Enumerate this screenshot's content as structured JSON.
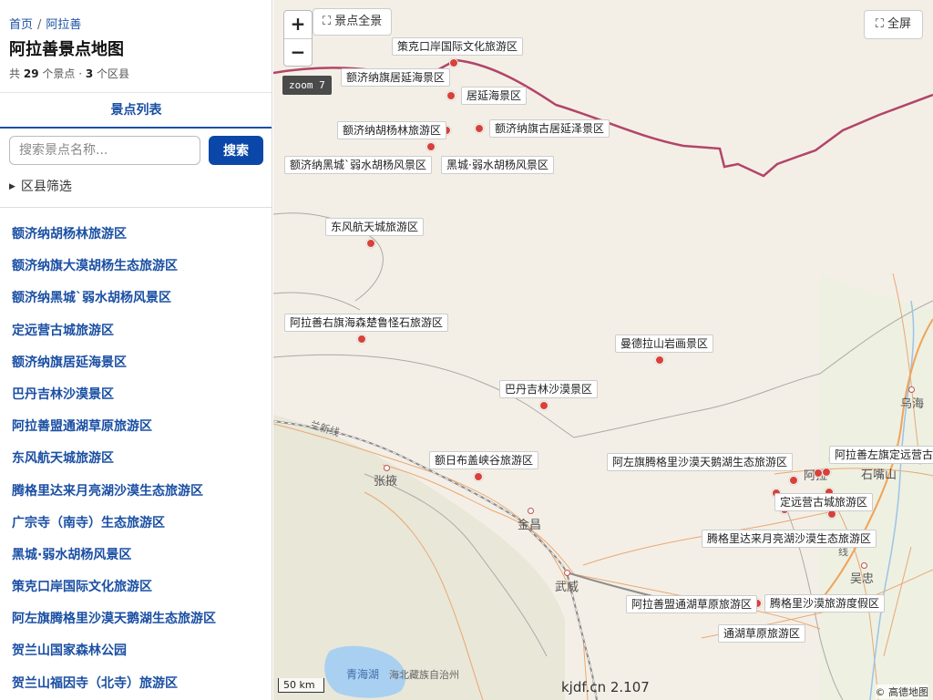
{
  "breadcrumb": {
    "home": "首页",
    "separator": "/",
    "current": "阿拉善"
  },
  "page_title": "阿拉善景点地图",
  "summary": {
    "prefix": "共",
    "spot_count": "29",
    "spot_unit": "个景点 ·",
    "district_count": "3",
    "district_unit": "个区县"
  },
  "tab_label": "景点列表",
  "search": {
    "placeholder": "搜索景点名称...",
    "button_label": "搜索"
  },
  "district_filter_label": "区县筛选",
  "spot_list": [
    "额济纳胡杨林旅游区",
    "额济纳旗大漠胡杨生态旅游区",
    "额济纳黑城`弱水胡杨风景区",
    "定远营古城旅游区",
    "额济纳旗居延海景区",
    "巴丹吉林沙漠景区",
    "阿拉善盟通湖草原旅游区",
    "东风航天城旅游区",
    "腾格里达来月亮湖沙漠生态旅游区",
    "广宗寺（南寺）生态旅游区",
    "黑城·弱水胡杨风景区",
    "策克口岸国际文化旅游区",
    "阿左旗腾格里沙漠天鹅湖生态旅游区",
    "贺兰山国家森林公园",
    "贺兰山福因寺（北寺）旅游区"
  ],
  "map": {
    "zoom_in": "+",
    "zoom_out": "−",
    "overview_icon": "expand-icon",
    "overview_label": "景点全景",
    "fullscreen_icon": "expand-icon",
    "fullscreen_label": "全屏",
    "zoom_level": "zoom 7",
    "scale": "50 km",
    "watermark": "kjdf.cn 2.107",
    "attribution": "© 高德地图",
    "poi_labels": {
      "ceke": "策克口岸国际文化旅游区",
      "juyanhai_qi": "额济纳旗居延海景区",
      "juyanhai": "居延海景区",
      "huyanglin": "额济纳胡杨林旅游区",
      "guju": "额济纳旗古居延泽景区",
      "heicheng_a": "额济纳黑城`弱水胡杨风景区",
      "heicheng_b": "黑城·弱水胡杨风景区",
      "dongfeng": "东风航天城旅游区",
      "haisenchulu": "阿拉善右旗海森楚鲁怪石旅游区",
      "mandela": "曼德拉山岩画景区",
      "badanjilin": "巴丹吉林沙漠景区",
      "eribugai": "额日布盖峡谷旅游区",
      "tiane": "阿左旗腾格里沙漠天鹅湖生态旅游区",
      "dingyuanying_far": "阿拉善左旗定远营古",
      "dingyuanying": "定远营古城旅游区",
      "yueliang": "腾格里达来月亮湖沙漠生态旅游区",
      "tonghu_meng": "阿拉善盟通湖草原旅游区",
      "tenggeli": "腾格里沙漠旅游度假区",
      "tonghu": "通湖草原旅游区"
    },
    "cities": {
      "zhangye": "张掖",
      "jinchang": "金昌",
      "wuwei": "武威",
      "wuhai": "乌海",
      "shizuishan": "石嘴山",
      "wuzhong": "吴忠",
      "alashan_partial": "阿拉",
      "qinghaihu": "青海湖",
      "haibei": "海北藏族自治州",
      "lanxin": "兰新线",
      "xian": "线"
    }
  }
}
